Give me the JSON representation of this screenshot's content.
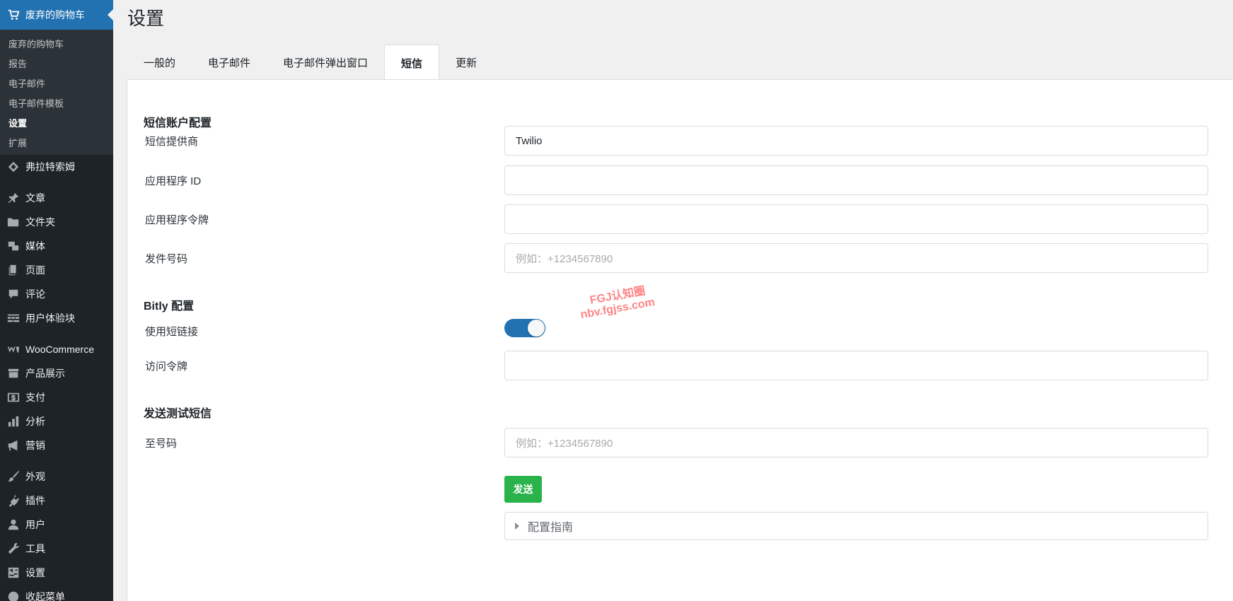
{
  "sidebar": {
    "current": "废弃的购物车",
    "submenu": [
      {
        "label": "废弃的购物车",
        "active": false
      },
      {
        "label": "报告",
        "active": false
      },
      {
        "label": "电子邮件",
        "active": false
      },
      {
        "label": "电子邮件模板",
        "active": false
      },
      {
        "label": "设置",
        "active": true
      },
      {
        "label": "扩展",
        "active": false
      }
    ],
    "items": [
      {
        "label": "弗拉特索姆",
        "icon": "diamond-icon"
      },
      {
        "label": "文章",
        "icon": "pin-icon"
      },
      {
        "label": "文件夹",
        "icon": "folder-icon"
      },
      {
        "label": "媒体",
        "icon": "media-icon"
      },
      {
        "label": "页面",
        "icon": "pages-icon"
      },
      {
        "label": "评论",
        "icon": "comment-icon"
      },
      {
        "label": "用户体验块",
        "icon": "blocks-icon"
      },
      {
        "label": "WooCommerce",
        "icon": "woo-icon"
      },
      {
        "label": "产品展示",
        "icon": "archive-icon"
      },
      {
        "label": "支付",
        "icon": "dollar-icon"
      },
      {
        "label": "分析",
        "icon": "chart-icon"
      },
      {
        "label": "营销",
        "icon": "megaphone-icon"
      },
      {
        "label": "外观",
        "icon": "brush-icon"
      },
      {
        "label": "插件",
        "icon": "plug-icon"
      },
      {
        "label": "用户",
        "icon": "user-icon"
      },
      {
        "label": "工具",
        "icon": "wrench-icon"
      },
      {
        "label": "设置",
        "icon": "settings-icon"
      },
      {
        "label": "收起菜单",
        "icon": "collapse-icon"
      }
    ]
  },
  "page": {
    "title": "设置",
    "tabs": [
      {
        "label": "一般的",
        "active": false
      },
      {
        "label": "电子邮件",
        "active": false
      },
      {
        "label": "电子邮件弹出窗口",
        "active": false
      },
      {
        "label": "短信",
        "active": true
      },
      {
        "label": "更新",
        "active": false
      }
    ]
  },
  "sms": {
    "section_account": "短信账户配置",
    "provider_label": "短信提供商",
    "provider_value": "Twilio",
    "app_id_label": "应用程序 ID",
    "app_id_value": "",
    "app_token_label": "应用程序令牌",
    "app_token_value": "",
    "from_label": "发件号码",
    "from_placeholder": "例如：+1234567890",
    "section_bitly": "Bitly 配置",
    "short_link_label": "使用短链接",
    "short_link_enabled": true,
    "access_token_label": "访问令牌",
    "access_token_value": "",
    "section_test": "发送测试短信",
    "to_label": "至号码",
    "to_placeholder": "例如：+1234567890",
    "send_label": "发送",
    "guide_label": "配置指南"
  },
  "watermark": {
    "line1": "FGJ认知圈",
    "line2": "nbv.fgjss.com"
  },
  "colors": {
    "sidebar_bg": "#1d2327",
    "accent": "#2271b1",
    "send_button": "#2bb34b",
    "watermark": "#ff6f6f"
  }
}
